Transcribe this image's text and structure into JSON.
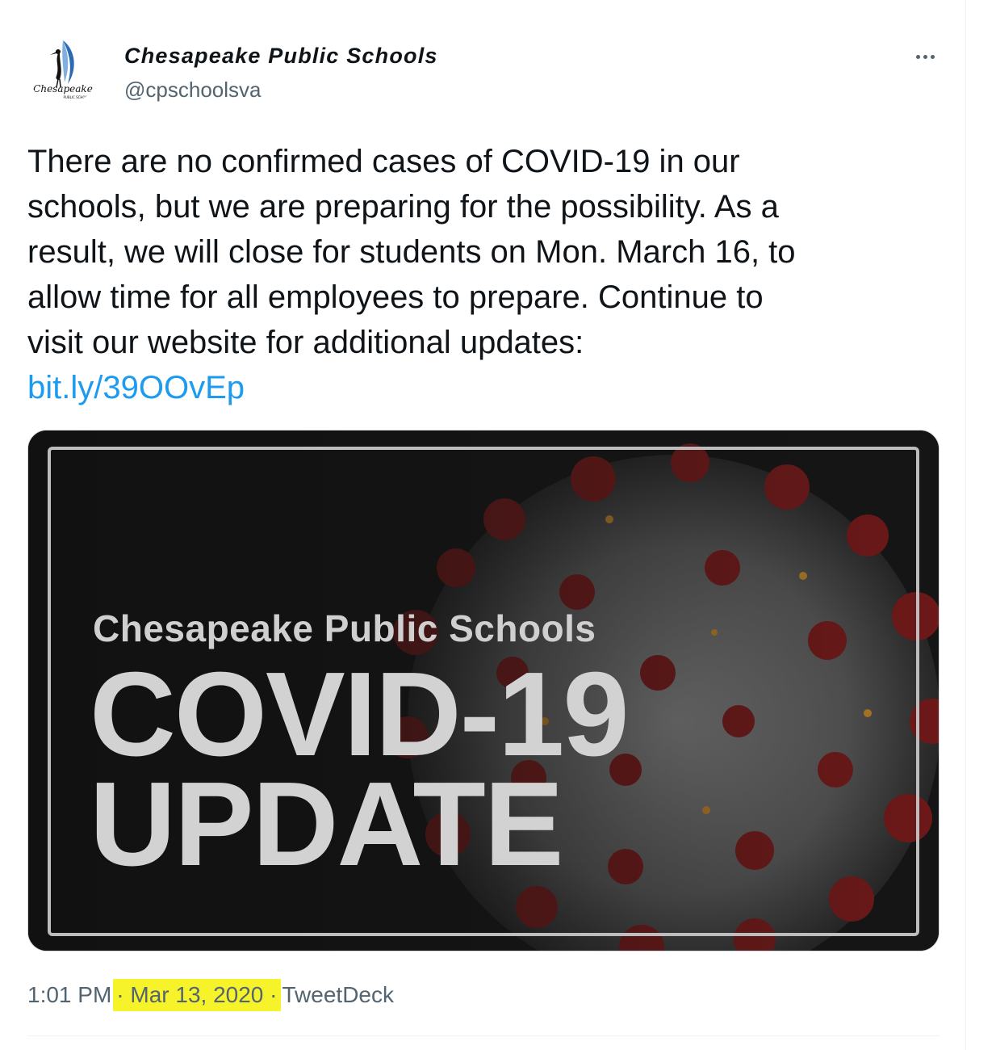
{
  "author": {
    "display_name": "Chesapeake Public Schools",
    "handle": "@cpschoolsva",
    "avatar_logo_text": "Chesapeake",
    "avatar_logo_subtext": "PUBLIC SCHOOLS"
  },
  "tweet": {
    "text_lines": [
      "There are no confirmed cases of COVID-19 in our",
      "schools, but we are preparing for the possibility. As a",
      "result, we will close for students on Mon. March 16, to",
      "allow time for all employees to prepare. Continue to",
      "visit our website for additional updates:"
    ],
    "link": "bit.ly/39OOvEp"
  },
  "media": {
    "title": "Chesapeake Public Schools",
    "headline_line1": "COVID-19",
    "headline_line2": "UPDATE"
  },
  "meta": {
    "time": "1:01 PM",
    "separator": "·",
    "date": "Mar 13, 2020",
    "source": "TweetDeck"
  },
  "colors": {
    "link": "#1d9bf0",
    "secondary_text": "#536471",
    "highlight": "#f7f32a",
    "virus_spike": "#8b1d1d"
  },
  "icons": {
    "more": "more-horizontal-icon"
  }
}
